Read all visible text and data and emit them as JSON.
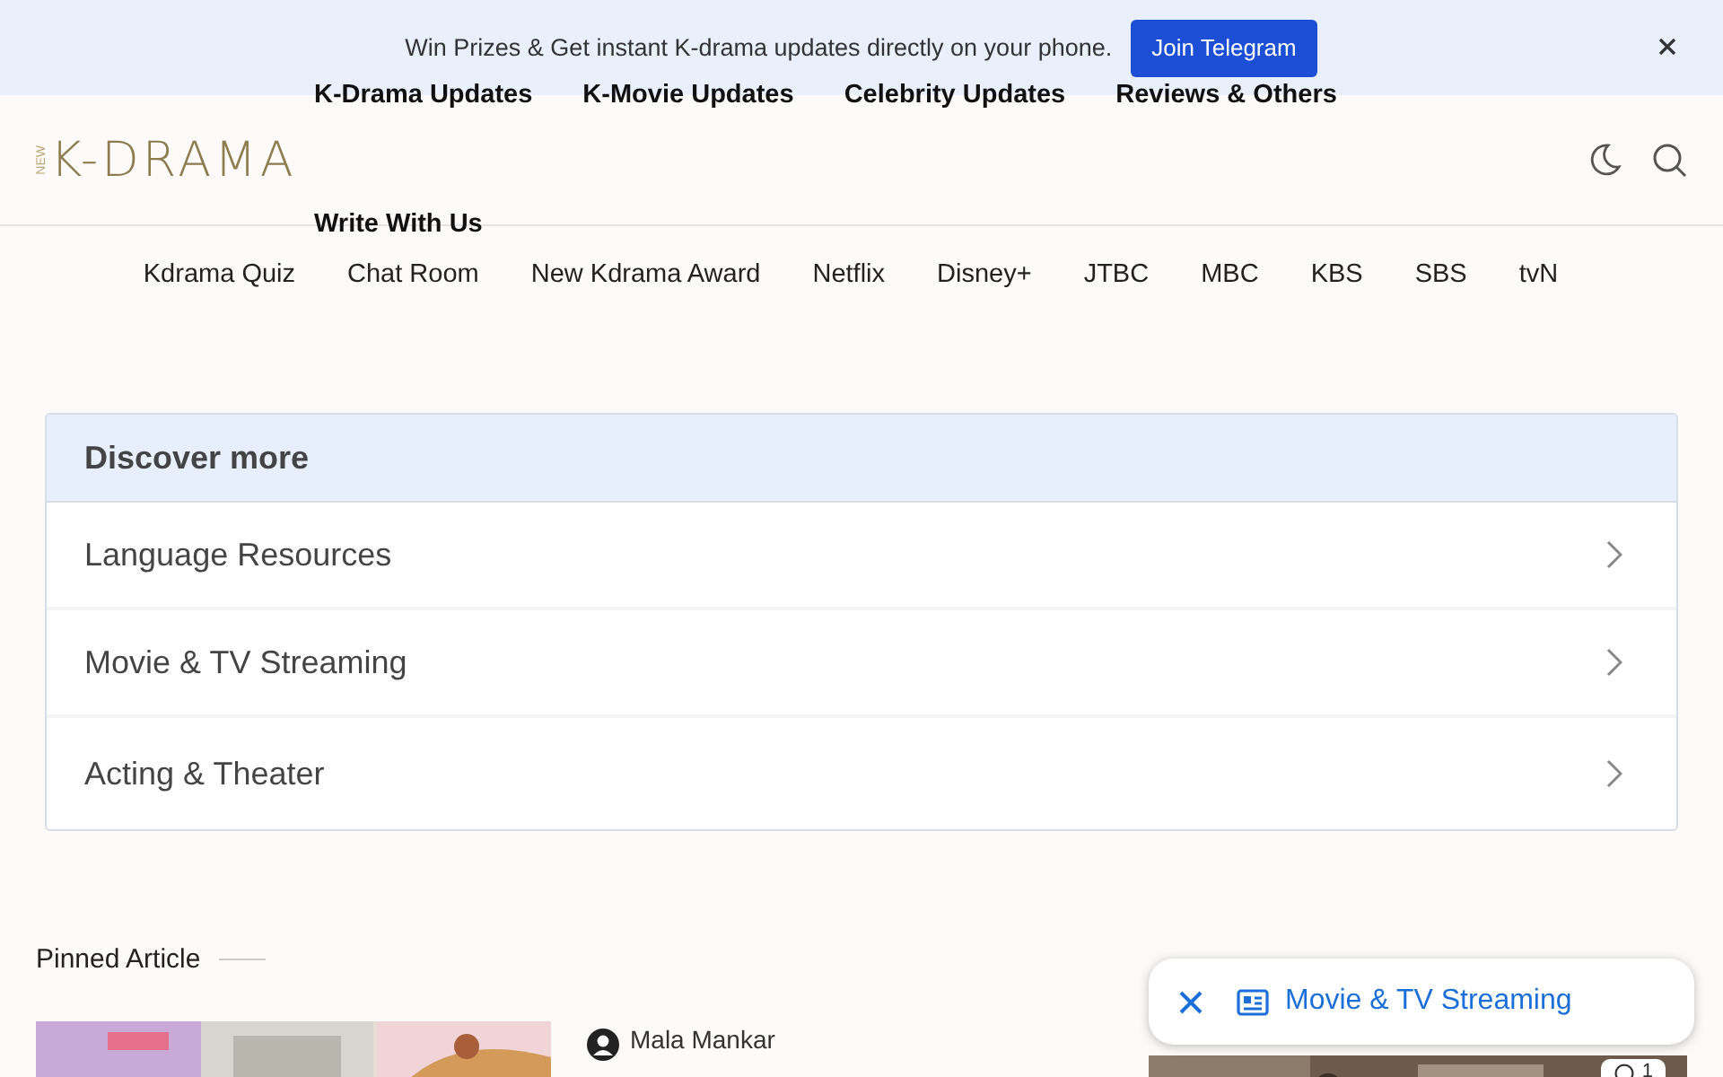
{
  "banner": {
    "message": "Win Prizes & Get instant K-drama updates directly on your phone.",
    "button": "Join Telegram"
  },
  "header": {
    "logo_small": "NEW",
    "logo": "K-DRAMA",
    "primary_nav": [
      "K-Drama Updates",
      "K-Movie Updates",
      "Celebrity Updates",
      "Reviews & Others",
      "Write With Us"
    ],
    "secondary_nav": [
      "Kdrama Quiz",
      "Chat Room",
      "New Kdrama Award",
      "Netflix",
      "Disney+",
      "JTBC",
      "MBC",
      "KBS",
      "SBS",
      "tvN"
    ]
  },
  "discover": {
    "title": "Discover more",
    "items": [
      "Language Resources",
      "Movie & TV Streaming",
      "Acting & Theater"
    ]
  },
  "pinned": {
    "heading": "Pinned Article",
    "author": "Mala Mankar",
    "comment_count": "1"
  },
  "floating_chip": {
    "label": "Movie & TV Streaming"
  }
}
